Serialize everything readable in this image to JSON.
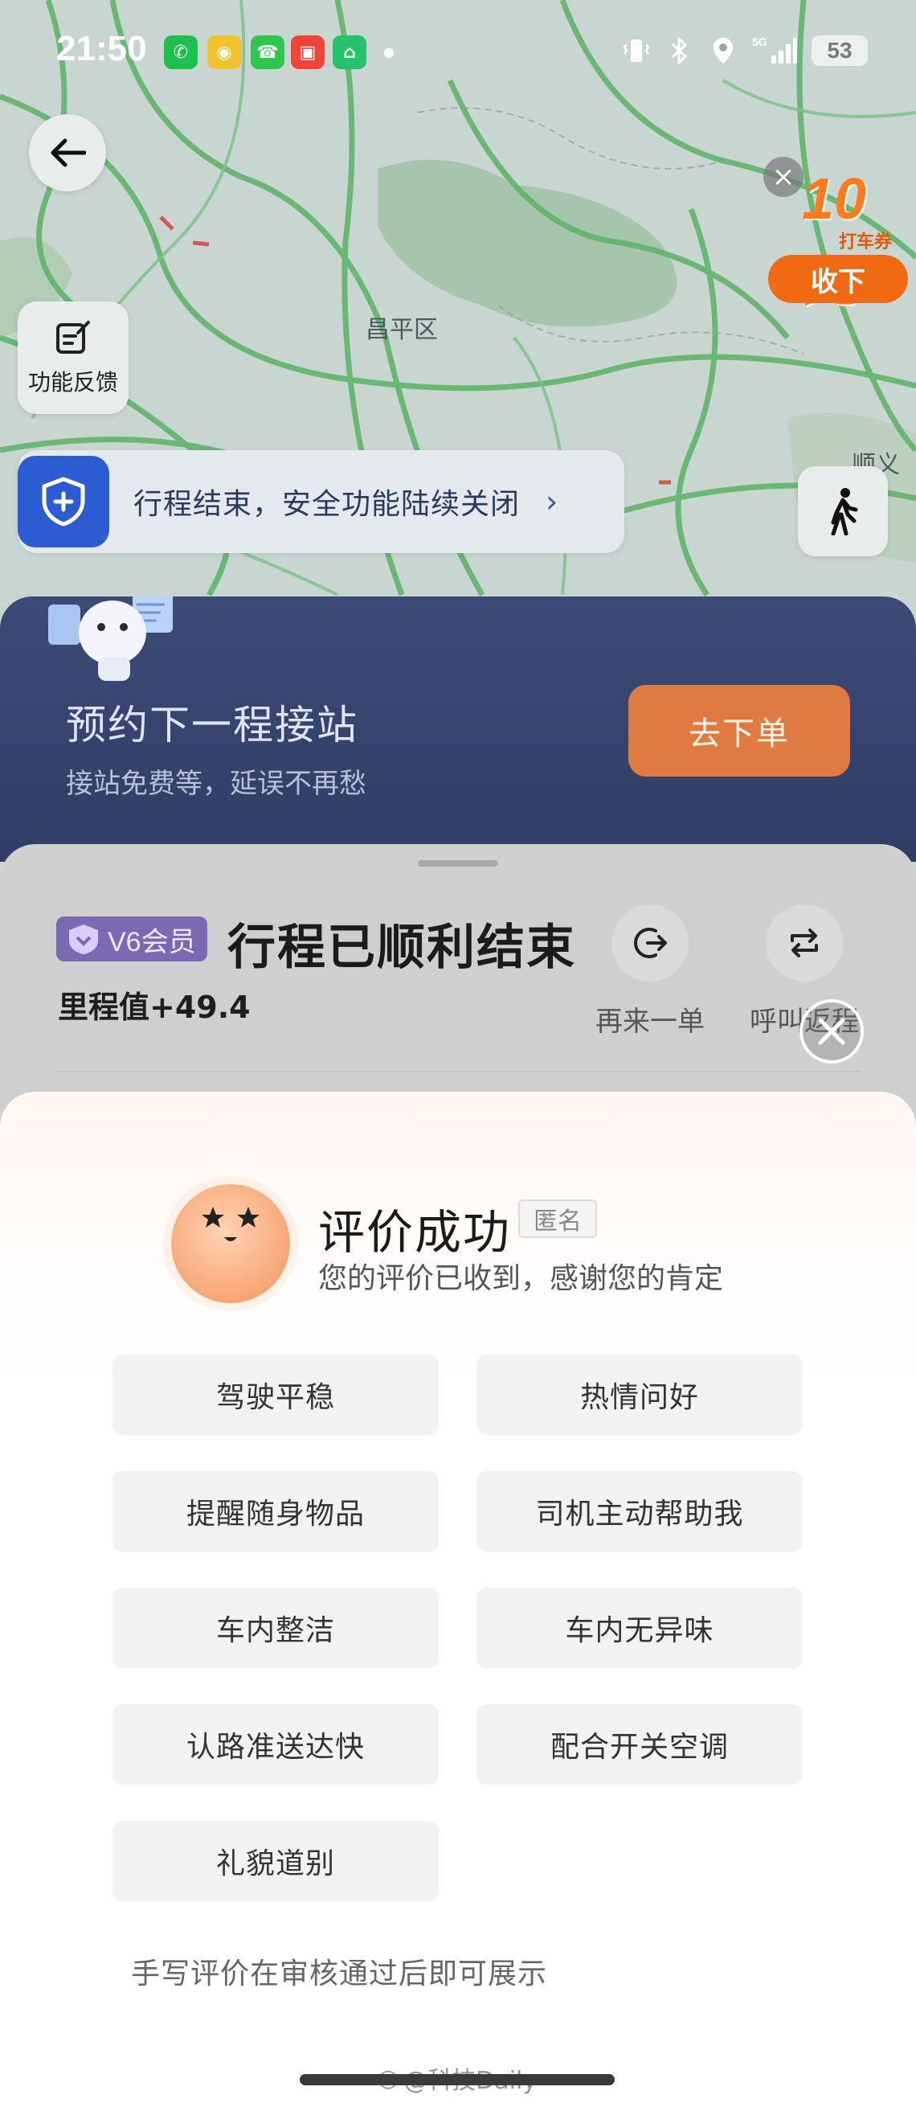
{
  "status_bar": {
    "time": "21:50",
    "network": "5G",
    "battery": "53",
    "apps": [
      "wechat-icon",
      "weibo-icon",
      "phone-icon",
      "taobao-icon",
      "mi-home-icon"
    ]
  },
  "map": {
    "district_1": "昌平区",
    "district_2": "顺义区"
  },
  "coupon": {
    "amount": "10元",
    "subtitle": "打车券",
    "collapse_label": "收下"
  },
  "feedback": {
    "label": "功能反馈"
  },
  "safety_banner": {
    "text": "行程结束，安全功能陆续关闭"
  },
  "promo": {
    "title": "预约下一程接站",
    "subtitle": "接站免费等，延误不再愁",
    "button_label": "去下单"
  },
  "trip": {
    "vip_label": "V6会员",
    "title": "行程已顺利结束",
    "mileage": "里程值+49.4",
    "action_again": "再来一单",
    "action_return": "呼叫返程"
  },
  "review": {
    "title": "评价成功",
    "anonymous_tag": "匿名",
    "subtitle": "您的评价已收到，感谢您的肯定",
    "tags": [
      "驾驶平稳",
      "热情问好",
      "提醒随身物品",
      "司机主动帮助我",
      "车内整洁",
      "车内无异味",
      "认路准送达快",
      "配合开关空调",
      "礼貌道别"
    ],
    "note": "手写评价在审核通过后即可展示"
  },
  "watermark": "@科技Daily",
  "colors": {
    "accent_orange": "#ef6a12",
    "safety_blue": "#2c5bd2",
    "promo_bg": "#34426c",
    "vip_purple": "#7a6ab3"
  }
}
